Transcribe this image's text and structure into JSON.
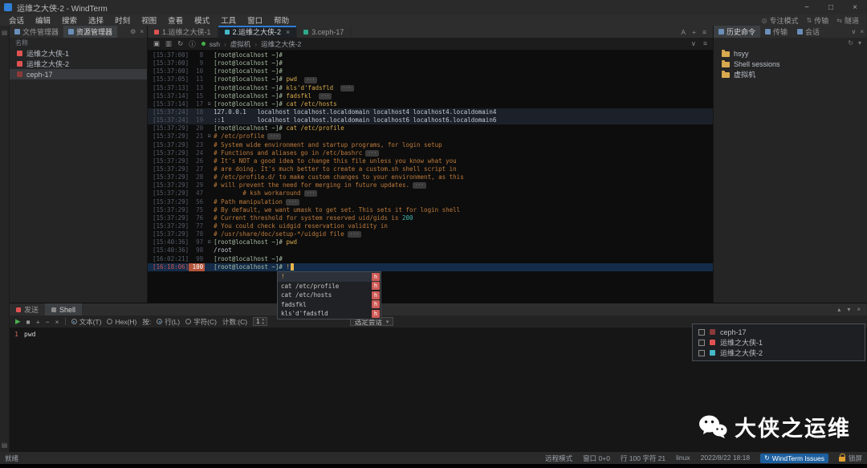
{
  "window": {
    "title": "运维之大侠-2 - WindTerm"
  },
  "menubar": {
    "items": [
      "会话",
      "编辑",
      "搜索",
      "选择",
      "时刻",
      "视图",
      "查看",
      "模式",
      "工具",
      "窗口",
      "帮助"
    ],
    "right_items": [
      "隧道",
      "传输",
      "专注模式"
    ]
  },
  "left_panel": {
    "tabs": [
      {
        "label": "文件管理器",
        "active": false
      },
      {
        "label": "资源管理器",
        "active": true
      }
    ],
    "header": "名称",
    "sessions": [
      {
        "label": "运维之大侠-1",
        "color": "#e05252",
        "selected": false
      },
      {
        "label": "运维之大侠-2",
        "color": "#e05252",
        "selected": false
      },
      {
        "label": "ceph-17",
        "color": "#8b3a3a",
        "selected": true
      }
    ]
  },
  "terminal": {
    "tabs": [
      {
        "label": "1.运维之大侠-1",
        "color": "#e05252",
        "active": false
      },
      {
        "label": "2.运维之大侠-2",
        "color": "#45b8c8",
        "active": true
      },
      {
        "label": "3.ceph-17",
        "color": "#2fa98c",
        "active": false
      }
    ],
    "breadcrumb": [
      "ssh",
      "虚拟机",
      "运维之大侠-2"
    ],
    "lines": [
      {
        "ts": "[15:37:00]",
        "n": "8",
        "seg": [
          [
            "p",
            "[root@localhost ~]# "
          ]
        ]
      },
      {
        "ts": "[15:37:00]",
        "n": "9",
        "seg": [
          [
            "p",
            "[root@localhost ~]# "
          ]
        ]
      },
      {
        "ts": "[15:37:00]",
        "n": "10",
        "seg": [
          [
            "p",
            "[root@localhost ~]# "
          ]
        ]
      },
      {
        "ts": "[15:37:05]",
        "n": "11",
        "seg": [
          [
            "p",
            "[root@localhost ~]# "
          ],
          [
            "c",
            "pwd "
          ]
        ],
        "fold": true
      },
      {
        "ts": "[15:37:13]",
        "n": "13",
        "seg": [
          [
            "p",
            "[root@localhost ~]# "
          ],
          [
            "c",
            "kls'd'fadsfld "
          ]
        ],
        "fold": true
      },
      {
        "ts": "[15:37:14]",
        "n": "15",
        "seg": [
          [
            "p",
            "[root@localhost ~]# "
          ],
          [
            "c",
            "fadsfkl "
          ]
        ],
        "fold": true
      },
      {
        "ts": "[15:37:14]",
        "n": "17",
        "g": true,
        "seg": [
          [
            "p",
            "[root@localhost ~]# "
          ],
          [
            "c",
            "cat /etc/hosts"
          ]
        ]
      },
      {
        "ts": "[15:37:24]",
        "n": "18",
        "hl": "sel",
        "seg": [
          [
            "t",
            "127.0.0.1   localhost localhost.localdomain localhost4 localhost4.localdomain4"
          ]
        ]
      },
      {
        "ts": "[15:37:24]",
        "n": "19",
        "hl": "sel",
        "seg": [
          [
            "t",
            "::1         localhost localhost.localdomain localhost6 localhost6.localdomain6"
          ]
        ]
      },
      {
        "ts": "[15:37:29]",
        "n": "20",
        "seg": [
          [
            "p",
            "[root@localhost ~]# "
          ],
          [
            "c",
            "cat /etc/profile"
          ]
        ]
      },
      {
        "ts": "[15:37:29]",
        "n": "21",
        "g": true,
        "seg": [
          [
            "m",
            "# /etc/profile"
          ]
        ],
        "fold": true
      },
      {
        "ts": "[15:37:29]",
        "n": "23",
        "seg": [
          [
            "m",
            "# System wide environment and startup programs, for login setup"
          ]
        ]
      },
      {
        "ts": "[15:37:29]",
        "n": "24",
        "seg": [
          [
            "m",
            "# Functions and aliases go in /etc/bashrc"
          ]
        ],
        "fold": true
      },
      {
        "ts": "[15:37:29]",
        "n": "26",
        "seg": [
          [
            "m",
            "# It's NOT a good idea to change this file unless you know what you"
          ]
        ]
      },
      {
        "ts": "[15:37:29]",
        "n": "27",
        "seg": [
          [
            "m",
            "# are doing. It's much better to create a custom.sh shell script in"
          ]
        ]
      },
      {
        "ts": "[15:37:29]",
        "n": "28",
        "seg": [
          [
            "m",
            "# /etc/profile.d/ to make custom changes to your environment, as this"
          ]
        ]
      },
      {
        "ts": "[15:37:29]",
        "n": "29",
        "seg": [
          [
            "m",
            "# will prevent the need for merging in future updates."
          ]
        ],
        "fold": true
      },
      {
        "ts": "[15:37:29]",
        "n": "47",
        "seg": [
          [
            "m",
            "        # ksh workaround"
          ]
        ],
        "fold": true
      },
      {
        "ts": "[15:37:29]",
        "n": "56",
        "seg": [
          [
            "m",
            "# Path manipulation"
          ]
        ],
        "fold": true
      },
      {
        "ts": "[15:37:29]",
        "n": "75",
        "seg": [
          [
            "m",
            "# By default, we want umask to get set. This sets it for login shell"
          ]
        ]
      },
      {
        "ts": "[15:37:29]",
        "n": "76",
        "seg": [
          [
            "m",
            "# Current threshold for system reserved uid/gids is "
          ],
          [
            "n",
            "200"
          ]
        ]
      },
      {
        "ts": "[15:37:29]",
        "n": "77",
        "seg": [
          [
            "m",
            "# You could check uidgid reservation validity in"
          ]
        ]
      },
      {
        "ts": "[15:37:29]",
        "n": "78",
        "seg": [
          [
            "m",
            "# /usr/share/doc/setup-*/uidgid file"
          ]
        ],
        "fold": true
      },
      {
        "ts": "[15:40:36]",
        "n": "97",
        "g": true,
        "seg": [
          [
            "p",
            "[root@localhost ~]# "
          ],
          [
            "c",
            "pwd"
          ]
        ]
      },
      {
        "ts": "[15:40:36]",
        "n": "98",
        "seg": [
          [
            "t",
            "/root"
          ]
        ]
      },
      {
        "ts": "[16:02:21]",
        "n": "99",
        "seg": [
          [
            "p",
            "[root@localhost ~]# "
          ]
        ]
      },
      {
        "ts": "[16:18:06]",
        "n": "100",
        "hl": "cur",
        "cursor": true,
        "seg": [
          [
            "p",
            "[root@localhost ~]# "
          ],
          [
            "c",
            "!"
          ]
        ]
      }
    ]
  },
  "autocomplete": {
    "badge": "h",
    "items": [
      {
        "text": "!",
        "selected": true
      },
      {
        "text": "cat /etc/profile",
        "selected": false
      },
      {
        "text": "cat /etc/hosts",
        "selected": false
      },
      {
        "text": "fadsfkl",
        "selected": false
      },
      {
        "text": "kls'd'fadsfld",
        "selected": false
      }
    ]
  },
  "send_panel": {
    "tabs": [
      {
        "label": "发送",
        "color": "#e05252",
        "active": false
      },
      {
        "label": "Shell",
        "color": "#8a8a8a",
        "active": true
      }
    ],
    "toolbar": {
      "text_radio": "文本(T)",
      "hex_radio": "Hex(H)",
      "by_label": "按:",
      "line_radio": "行(L)",
      "char_radio": "字符(C)",
      "count_label": "计数:(C)",
      "count_value": "1",
      "combo_label": "选定会话"
    },
    "content": {
      "line_no": "1",
      "text": "pwd"
    }
  },
  "right_panel": {
    "tabs": [
      {
        "label": "历史命令",
        "active": true
      },
      {
        "label": "传输",
        "active": false
      },
      {
        "label": "会话",
        "active": false
      }
    ],
    "tree": [
      {
        "label": "hsyy"
      },
      {
        "label": "Shell sessions"
      },
      {
        "label": "虚拟机"
      }
    ]
  },
  "session_popup": {
    "items": [
      {
        "label": "ceph-17",
        "color": "#8b3a3a"
      },
      {
        "label": "运维之大侠-1",
        "color": "#e05252"
      },
      {
        "label": "运维之大侠-2",
        "color": "#45b8c8"
      }
    ]
  },
  "watermark": {
    "text": "大侠之运维"
  },
  "statusbar": {
    "ready": "就绪",
    "items": [
      "远程模式",
      "窗口 0+0",
      "行 100 字符 21",
      "linux",
      "2022/8/22 18:18"
    ],
    "issues": "WindTerm Issues",
    "lock_label": "锁屏"
  }
}
